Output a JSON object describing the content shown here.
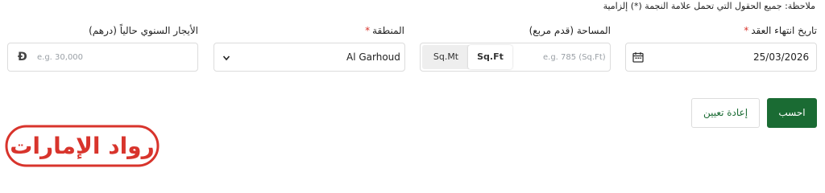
{
  "note": "ملاحظة: جميع الحقول التي تحمل علامة النجمة (*) إلزامية",
  "fields": {
    "date": {
      "label": "تاريخ انتهاء العقد",
      "required": "*",
      "value": "25/03/2026"
    },
    "area": {
      "label": "المساحة (قدم مربع)",
      "placeholder": "e.g. 785 (Sq.Ft)",
      "units": [
        "Sq.Ft",
        "Sq.Mt"
      ],
      "selected_unit": "Sq.Ft"
    },
    "region": {
      "label": "المنطقة",
      "required": "*",
      "value": "Al Garhoud"
    },
    "rent": {
      "label": "الأيجار السنوي حالياً (درهم)",
      "placeholder": "e.g. 30,000",
      "currency_icon": "dirham-icon"
    }
  },
  "buttons": {
    "calculate": "احسب",
    "reset": "إعادة تعيين"
  },
  "logo": {
    "text": "رواد الإمارات",
    "color": "#d8342c"
  },
  "colors": {
    "primary": "#1a6b33",
    "required": "#d8342c"
  }
}
